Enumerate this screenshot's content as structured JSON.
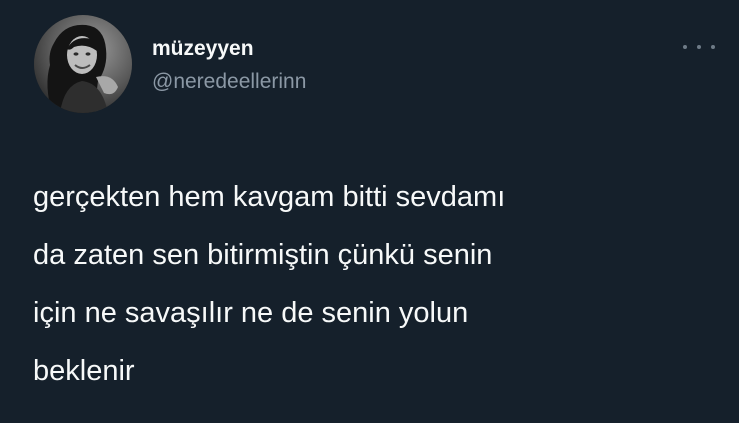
{
  "tweet": {
    "display_name": "müzeyyen",
    "handle": "@neredeellerinn",
    "text_lines": [
      "gerçekten hem kavgam bitti sevdamı",
      "da zaten sen bitirmiştin çünkü senin",
      "için ne savaşılır ne de senin yolun",
      "beklenir"
    ]
  },
  "icons": {
    "avatar": "profile-photo-icon",
    "more": "more-options-icon"
  },
  "colors": {
    "background": "#15202b",
    "primary_text": "#f7f9f9",
    "secondary_text": "#8b98a5",
    "icon_gray": "#6e7b87"
  }
}
